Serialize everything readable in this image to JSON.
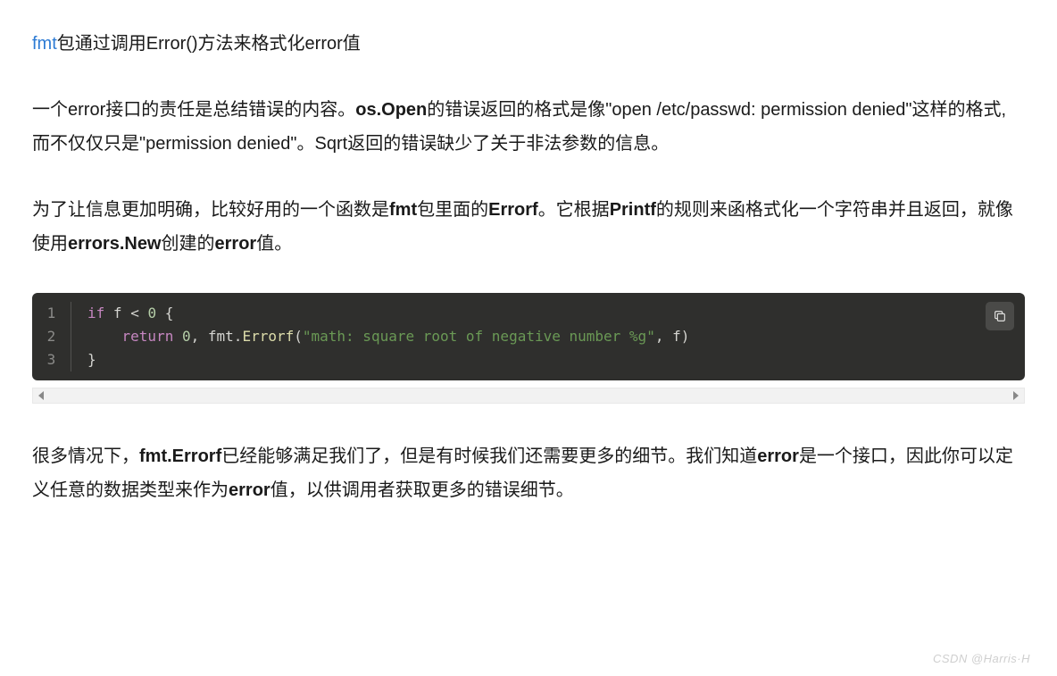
{
  "para1": {
    "link": "fmt",
    "rest": "包通过调用Error()方法来格式化error值"
  },
  "para2": {
    "t1": "一个error接口的责任是总结错误的内容。",
    "b1": "os.Open",
    "t2": "的错误返回的格式是像\"open /etc/passwd: permission denied\"这样的格式, 而不仅仅只是\"permission denied\"。Sqrt返回的错误缺少了关于非法参数的信息。"
  },
  "para3": {
    "t1": "为了让信息更加明确，比较好用的一个函数是",
    "b1": "fmt",
    "t2": "包里面的",
    "b2": "Errorf",
    "t3": "。它根据",
    "b3": "Printf",
    "t4": "的规则来函格式化一个字符串并且返回，就像使用",
    "b4": "errors.New",
    "t5": "创建的",
    "b5": "error",
    "t6": "值。"
  },
  "code": {
    "nums": [
      "1",
      "2",
      "3"
    ],
    "l1": {
      "kw": "if",
      "var": "f",
      "op": "<",
      "num": "0",
      "brace": "{"
    },
    "l2": {
      "kw": "return",
      "num": "0",
      "comma": ",",
      "pkg": "fmt",
      "dot": ".",
      "fn": "Errorf",
      "lp": "(",
      "str": "\"math: square root of negative number %g\"",
      "comma2": ",",
      "arg": "f",
      "rp": ")"
    },
    "l3": {
      "brace": "}"
    }
  },
  "para4": {
    "t1": "很多情况下，",
    "b1": "fmt.Errorf",
    "t2": "已经能够满足我们了，但是有时候我们还需要更多的细节。我们知道",
    "b2": "error",
    "t3": "是一个接口，因此你可以定义任意的数据类型来作为",
    "b3": "error",
    "t4": "值，以供调用者获取更多的错误细节。"
  },
  "watermark": "CSDN @Harris·H"
}
